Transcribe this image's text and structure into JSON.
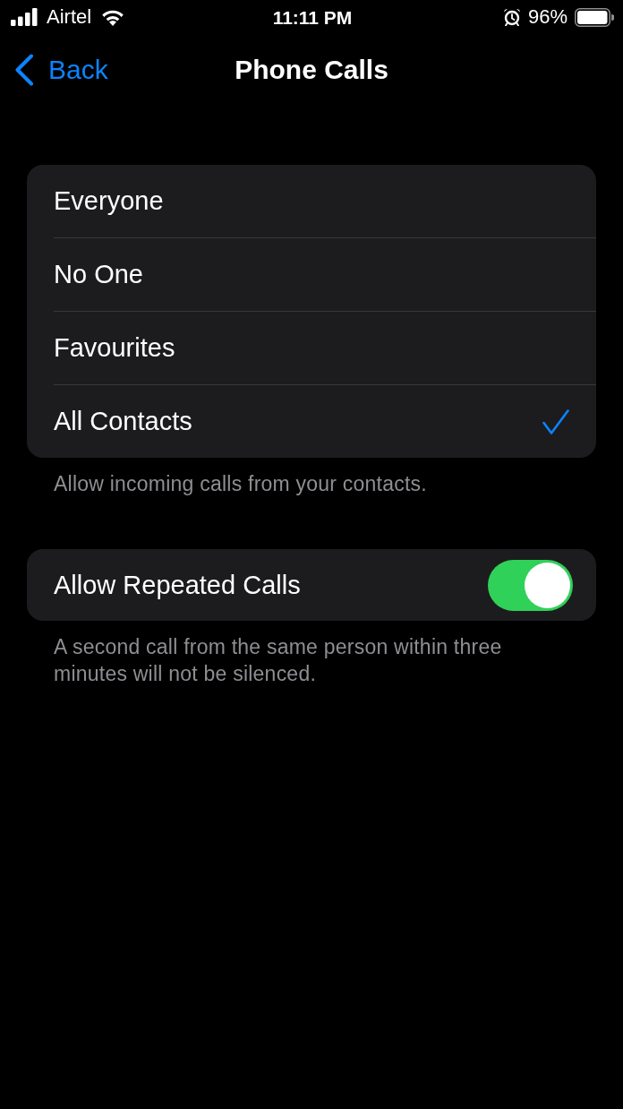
{
  "status_bar": {
    "carrier": "Airtel",
    "time": "11:11 PM",
    "battery": "96%"
  },
  "nav": {
    "back": "Back",
    "title": "Phone Calls"
  },
  "options": [
    {
      "label": "Everyone",
      "selected": false
    },
    {
      "label": "No One",
      "selected": false
    },
    {
      "label": "Favourites",
      "selected": false
    },
    {
      "label": "All Contacts",
      "selected": true
    }
  ],
  "options_footer": "Allow incoming calls from your contacts.",
  "repeated_calls": {
    "label": "Allow Repeated Calls",
    "on": true
  },
  "repeated_footer": "A second call from the same person within three minutes will not be silenced."
}
